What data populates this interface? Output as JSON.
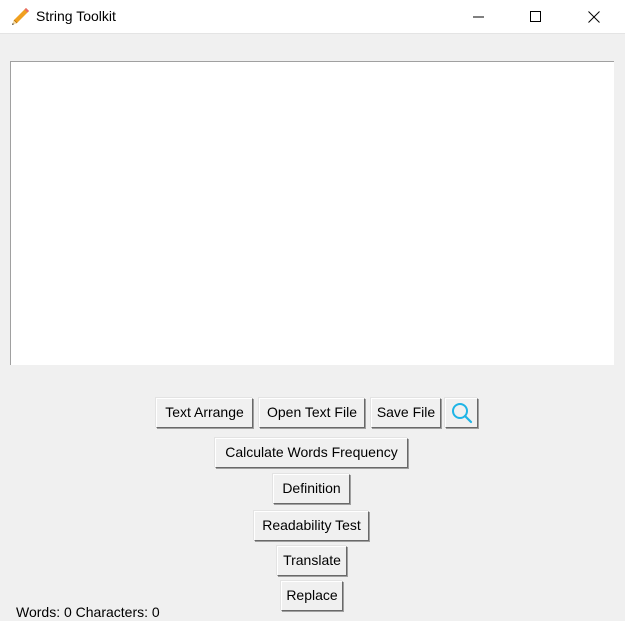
{
  "window": {
    "title": "String Toolkit"
  },
  "editor": {
    "content": ""
  },
  "buttons": {
    "text_arrange": "Text Arrange",
    "open_text_file": "Open Text File",
    "save_file": "Save File",
    "search_icon": "search-icon",
    "calculate_words_frequency": "Calculate Words Frequency",
    "definition": "Definition",
    "readability_test": "Readability Test",
    "translate": "Translate",
    "replace": "Replace"
  },
  "status": {
    "text": "Words: 0 Characters: 0"
  },
  "colors": {
    "background": "#f0f0f0",
    "search_icon": "#1eb4e6",
    "pencil": "#f0a020"
  }
}
